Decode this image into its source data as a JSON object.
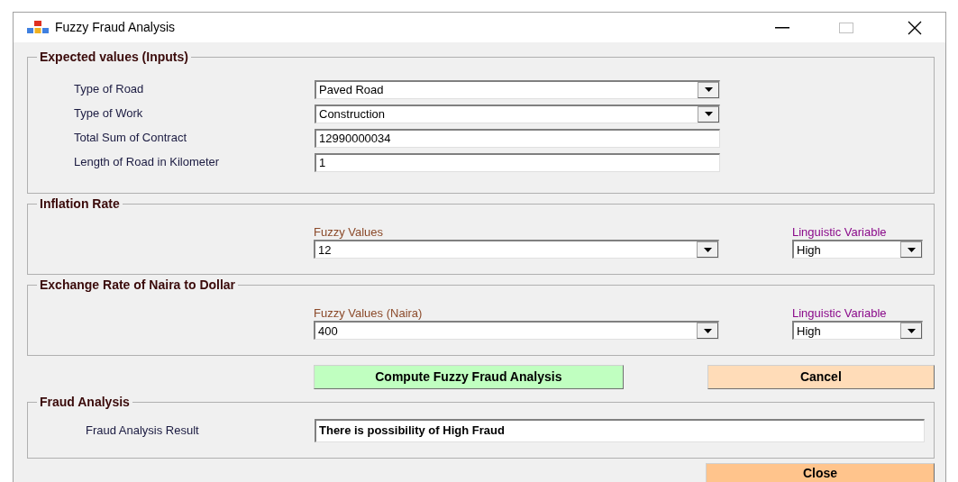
{
  "window": {
    "title": "Fuzzy Fraud Analysis"
  },
  "inputs": {
    "title": "Expected values (Inputs)",
    "fields": [
      {
        "label": "Type of Road",
        "kind": "dropdown",
        "value": "Paved Road"
      },
      {
        "label": "Type of Work",
        "kind": "dropdown",
        "value": "Construction"
      },
      {
        "label": "Total Sum of Contract",
        "kind": "text",
        "value": "12990000034"
      },
      {
        "label": "Length of Road in Kilometer",
        "kind": "text",
        "value": "1"
      }
    ]
  },
  "rates": [
    {
      "title": "Inflation Rate",
      "fuzzy_label": "Fuzzy Values",
      "fuzzy_value": "12",
      "linguistic_label": "Linguistic Variable",
      "linguistic_value": "High"
    },
    {
      "title": "Exchange Rate of Naira to Dollar",
      "fuzzy_label": "Fuzzy Values (Naira)",
      "fuzzy_value": "400",
      "linguistic_label": "Linguistic Variable",
      "linguistic_value": "High"
    }
  ],
  "buttons": [
    {
      "label": "Compute Fuzzy Fraud Analysis",
      "kind": "compute"
    },
    {
      "label": "Cancel",
      "kind": "cancel"
    }
  ],
  "result": {
    "title": "Fraud Analysis",
    "label": "Fraud Analysis Result",
    "value": "There is possibility of High Fraud"
  },
  "close_button": {
    "label": "Close"
  }
}
